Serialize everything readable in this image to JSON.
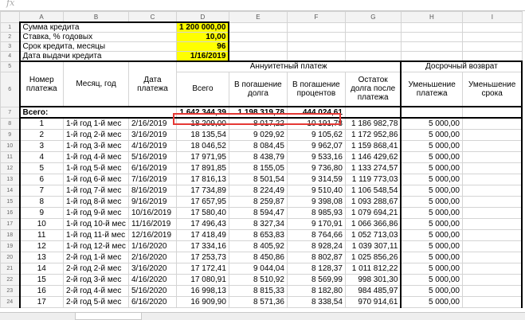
{
  "formula_bar": {
    "label": "fx"
  },
  "columns": [
    "A",
    "B",
    "C",
    "D",
    "E",
    "F",
    "G",
    "H",
    "I"
  ],
  "summary": [
    {
      "row": "1",
      "label": "Сумма кредита",
      "value": "1 200 000,00"
    },
    {
      "row": "2",
      "label": "Ставка, % годовых",
      "value": "10,00"
    },
    {
      "row": "3",
      "label": "Срок кредита, месяцы",
      "value": "96"
    },
    {
      "row": "4",
      "label": "Дата выдачи кредита",
      "value": "1/16/2019"
    }
  ],
  "header": {
    "row5": "5",
    "row6": "6",
    "annuity": "Аннуитетный платеж",
    "early": "Досрочный возврат",
    "payment_no": "Номер платежа",
    "month_year": "Месяц, год",
    "pay_date": "Дата платежа",
    "total": "Всего",
    "principal": "В погашение долга",
    "interest": "В погашение процентов",
    "remaining": "Остаток долга после платежа",
    "reduce_payment": "Уменьшение платежа",
    "reduce_term": "Уменьшение срока"
  },
  "totals": {
    "row": "7",
    "label": "Всего:",
    "total": "1 642 344,39",
    "principal": "1 198 319,78",
    "interest": "444 024,61"
  },
  "rows": [
    {
      "rn": "8",
      "no": "1",
      "month": "1-й год 1-й мес",
      "date": "2/16/2019",
      "total": "18 209,00",
      "principal": "8 017,22",
      "interest": "10 191,78",
      "remaining": "1 186 982,78",
      "early": "5 000,00"
    },
    {
      "rn": "9",
      "no": "2",
      "month": "1-й год 2-й мес",
      "date": "3/16/2019",
      "total": "18 135,54",
      "principal": "9 029,92",
      "interest": "9 105,62",
      "remaining": "1 172 952,86",
      "early": "5 000,00"
    },
    {
      "rn": "10",
      "no": "3",
      "month": "1-й год 3-й мес",
      "date": "4/16/2019",
      "total": "18 046,52",
      "principal": "8 084,45",
      "interest": "9 962,07",
      "remaining": "1 159 868,41",
      "early": "5 000,00"
    },
    {
      "rn": "11",
      "no": "4",
      "month": "1-й год 4-й мес",
      "date": "5/16/2019",
      "total": "17 971,95",
      "principal": "8 438,79",
      "interest": "9 533,16",
      "remaining": "1 146 429,62",
      "early": "5 000,00"
    },
    {
      "rn": "12",
      "no": "5",
      "month": "1-й год 5-й мес",
      "date": "6/16/2019",
      "total": "17 891,85",
      "principal": "8 155,05",
      "interest": "9 736,80",
      "remaining": "1 133 274,57",
      "early": "5 000,00"
    },
    {
      "rn": "13",
      "no": "6",
      "month": "1-й год 6-й мес",
      "date": "7/16/2019",
      "total": "17 816,13",
      "principal": "8 501,54",
      "interest": "9 314,59",
      "remaining": "1 119 773,03",
      "early": "5 000,00"
    },
    {
      "rn": "14",
      "no": "7",
      "month": "1-й год 7-й мес",
      "date": "8/16/2019",
      "total": "17 734,89",
      "principal": "8 224,49",
      "interest": "9 510,40",
      "remaining": "1 106 548,54",
      "early": "5 000,00"
    },
    {
      "rn": "15",
      "no": "8",
      "month": "1-й год 8-й мес",
      "date": "9/16/2019",
      "total": "17 657,95",
      "principal": "8 259,87",
      "interest": "9 398,08",
      "remaining": "1 093 288,67",
      "early": "5 000,00"
    },
    {
      "rn": "16",
      "no": "9",
      "month": "1-й год 9-й мес",
      "date": "10/16/2019",
      "total": "17 580,40",
      "principal": "8 594,47",
      "interest": "8 985,93",
      "remaining": "1 079 694,21",
      "early": "5 000,00"
    },
    {
      "rn": "17",
      "no": "10",
      "month": "1-й год 10-й мес",
      "date": "11/16/2019",
      "total": "17 496,43",
      "principal": "8 327,34",
      "interest": "9 170,91",
      "remaining": "1 066 366,86",
      "early": "5 000,00"
    },
    {
      "rn": "18",
      "no": "11",
      "month": "1-й год 11-й мес",
      "date": "12/16/2019",
      "total": "17 418,49",
      "principal": "8 653,83",
      "interest": "8 764,66",
      "remaining": "1 052 713,03",
      "early": "5 000,00"
    },
    {
      "rn": "19",
      "no": "12",
      "month": "1-й год 12-й мес",
      "date": "1/16/2020",
      "total": "17 334,16",
      "principal": "8 405,92",
      "interest": "8 928,24",
      "remaining": "1 039 307,11",
      "early": "5 000,00"
    },
    {
      "rn": "20",
      "no": "13",
      "month": "2-й год 1-й мес",
      "date": "2/16/2020",
      "total": "17 253,73",
      "principal": "8 450,86",
      "interest": "8 802,87",
      "remaining": "1 025 856,26",
      "early": "5 000,00"
    },
    {
      "rn": "21",
      "no": "14",
      "month": "2-й год 2-й мес",
      "date": "3/16/2020",
      "total": "17 172,41",
      "principal": "9 044,04",
      "interest": "8 128,37",
      "remaining": "1 011 812,22",
      "early": "5 000,00"
    },
    {
      "rn": "22",
      "no": "15",
      "month": "2-й год 3-й мес",
      "date": "4/16/2020",
      "total": "17 080,91",
      "principal": "8 510,92",
      "interest": "8 569,99",
      "remaining": "998 301,30",
      "early": "5 000,00"
    },
    {
      "rn": "23",
      "no": "16",
      "month": "2-й год 4-й мес",
      "date": "5/16/2020",
      "total": "16 998,13",
      "principal": "8 815,33",
      "interest": "8 182,80",
      "remaining": "984 485,97",
      "early": "5 000,00"
    },
    {
      "rn": "24",
      "no": "17",
      "month": "2-й год 5-й мес",
      "date": "6/16/2020",
      "total": "16 909,90",
      "principal": "8 571,36",
      "interest": "8 338,54",
      "remaining": "970 914,61",
      "early": "5 000,00"
    }
  ],
  "colors": {
    "highlight": "#ffff00",
    "callout": "#e53935",
    "header_bg": "#f3f3f3"
  }
}
